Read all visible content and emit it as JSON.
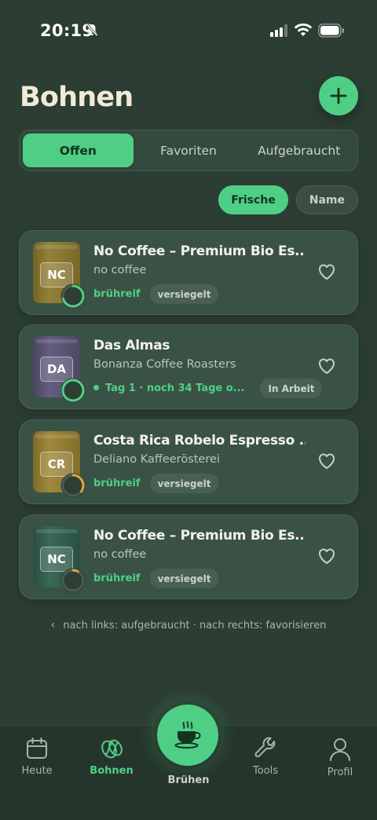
{
  "status_bar": {
    "time": "20:19"
  },
  "header": {
    "title": "Bohnen"
  },
  "segments": [
    {
      "label": "Offen",
      "active": true
    },
    {
      "label": "Favoriten",
      "active": false
    },
    {
      "label": "Aufgebraucht",
      "active": false
    }
  ],
  "sort": {
    "freshness": "Frische",
    "name": "Name",
    "active": "Frische"
  },
  "beans": [
    {
      "initials": "NC",
      "name": "No Coffee – Premium Bio Es...",
      "roaster": "no coffee",
      "state": "brühreif",
      "tag": "versiegelt",
      "bag_color": "#8d7a2e",
      "ring_color": "#4fcf85",
      "freshness": 0.7
    },
    {
      "initials": "DA",
      "name": "Das Almas",
      "roaster": "Bonanza Coffee Roasters",
      "state": "Tag 1 · noch 34 Tage o...",
      "tag": "In Arbeit",
      "bag_color": "#5b5478",
      "ring_color": "#4fcf85",
      "freshness": 0.97
    },
    {
      "initials": "CR",
      "name": "Costa Rica Robelo Espresso ...",
      "roaster": "Deliano Kaffeerösterei",
      "state": "brühreif",
      "tag": "versiegelt",
      "bag_color": "#9a8230",
      "ring_color": "#e3a347",
      "freshness": 0.35
    },
    {
      "initials": "NC",
      "name": "No Coffee – Premium Bio Es...",
      "roaster": "no coffee",
      "state": "brühreif",
      "tag": "versiegelt",
      "bag_color": "#2f5f4c",
      "ring_color": "#e3a347",
      "freshness": 0.08
    }
  ],
  "swipe_hint": "nach links: aufgebraucht · nach rechts: favorisieren",
  "tabbar": {
    "today": "Heute",
    "beans": "Bohnen",
    "brew": "Brühen",
    "tools": "Tools",
    "profile": "Profil",
    "active": "Bohnen"
  },
  "colors": {
    "accent": "#4fcf85",
    "background": "#2c3d33",
    "card": "#3a5245",
    "warn": "#e3a347"
  }
}
